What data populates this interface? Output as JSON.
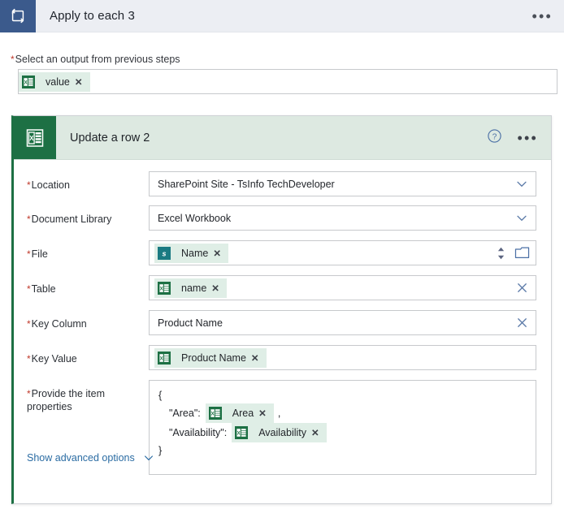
{
  "loop": {
    "icon": "apply-to-each-loop-icon",
    "title": "Apply to each 3",
    "more_label": "•••"
  },
  "output_selector": {
    "label": "Select an output from previous steps",
    "required_marker": "*",
    "token": {
      "icon": "excel-token-icon",
      "label": "value",
      "remove_label": "✕"
    }
  },
  "card": {
    "icon": "excel-workbook-icon",
    "title": "Update a row 2",
    "help_label": "?",
    "more_label": "•••",
    "accent_color": "#1d7044",
    "header_bg": "#dde9e1"
  },
  "fields": [
    {
      "name": "location",
      "label": "Location",
      "required_marker": "*",
      "type": "dropdown",
      "value": "SharePoint Site - TsInfo TechDeveloper",
      "trailing_icon": "chevron-down-icon"
    },
    {
      "name": "document-library",
      "label": "Document Library",
      "required_marker": "*",
      "type": "dropdown",
      "value": "Excel Workbook",
      "trailing_icon": "chevron-down-icon"
    },
    {
      "name": "file",
      "label": "File",
      "required_marker": "*",
      "type": "token-picker",
      "token": {
        "icon": "sharepoint-token-icon",
        "label": "Name",
        "remove_label": "✕"
      },
      "trailing_icons": [
        "spinner-updown-icon",
        "folder-picker-icon"
      ]
    },
    {
      "name": "table",
      "label": "Table",
      "required_marker": "*",
      "type": "token",
      "token": {
        "icon": "excel-token-icon",
        "label": "name",
        "remove_label": "✕"
      },
      "trailing_icon": "clear-x-icon"
    },
    {
      "name": "key-column",
      "label": "Key Column",
      "required_marker": "*",
      "type": "text",
      "value": "Product Name",
      "trailing_icon": "clear-x-icon"
    },
    {
      "name": "key-value",
      "label": "Key Value",
      "required_marker": "*",
      "type": "token",
      "token": {
        "icon": "excel-token-icon",
        "label": "Product Name",
        "remove_label": "✕"
      },
      "trailing_icon": ""
    }
  ],
  "item_properties": {
    "label_line1": "Provide the item",
    "label_line2": "properties",
    "required_marker": "*",
    "open_brace": "{",
    "close_brace": "}",
    "entries": [
      {
        "key": "\"Area\":",
        "token": {
          "icon": "excel-token-icon",
          "label": "Area",
          "remove_label": "✕"
        },
        "trailing": ","
      },
      {
        "key": "\"Availability\":",
        "token": {
          "icon": "excel-token-icon",
          "label": "Availability",
          "remove_label": "✕"
        },
        "trailing": ""
      }
    ]
  },
  "advanced": {
    "label": "Show advanced options",
    "icon": "chevron-down-icon",
    "color": "#2b6ca3"
  }
}
